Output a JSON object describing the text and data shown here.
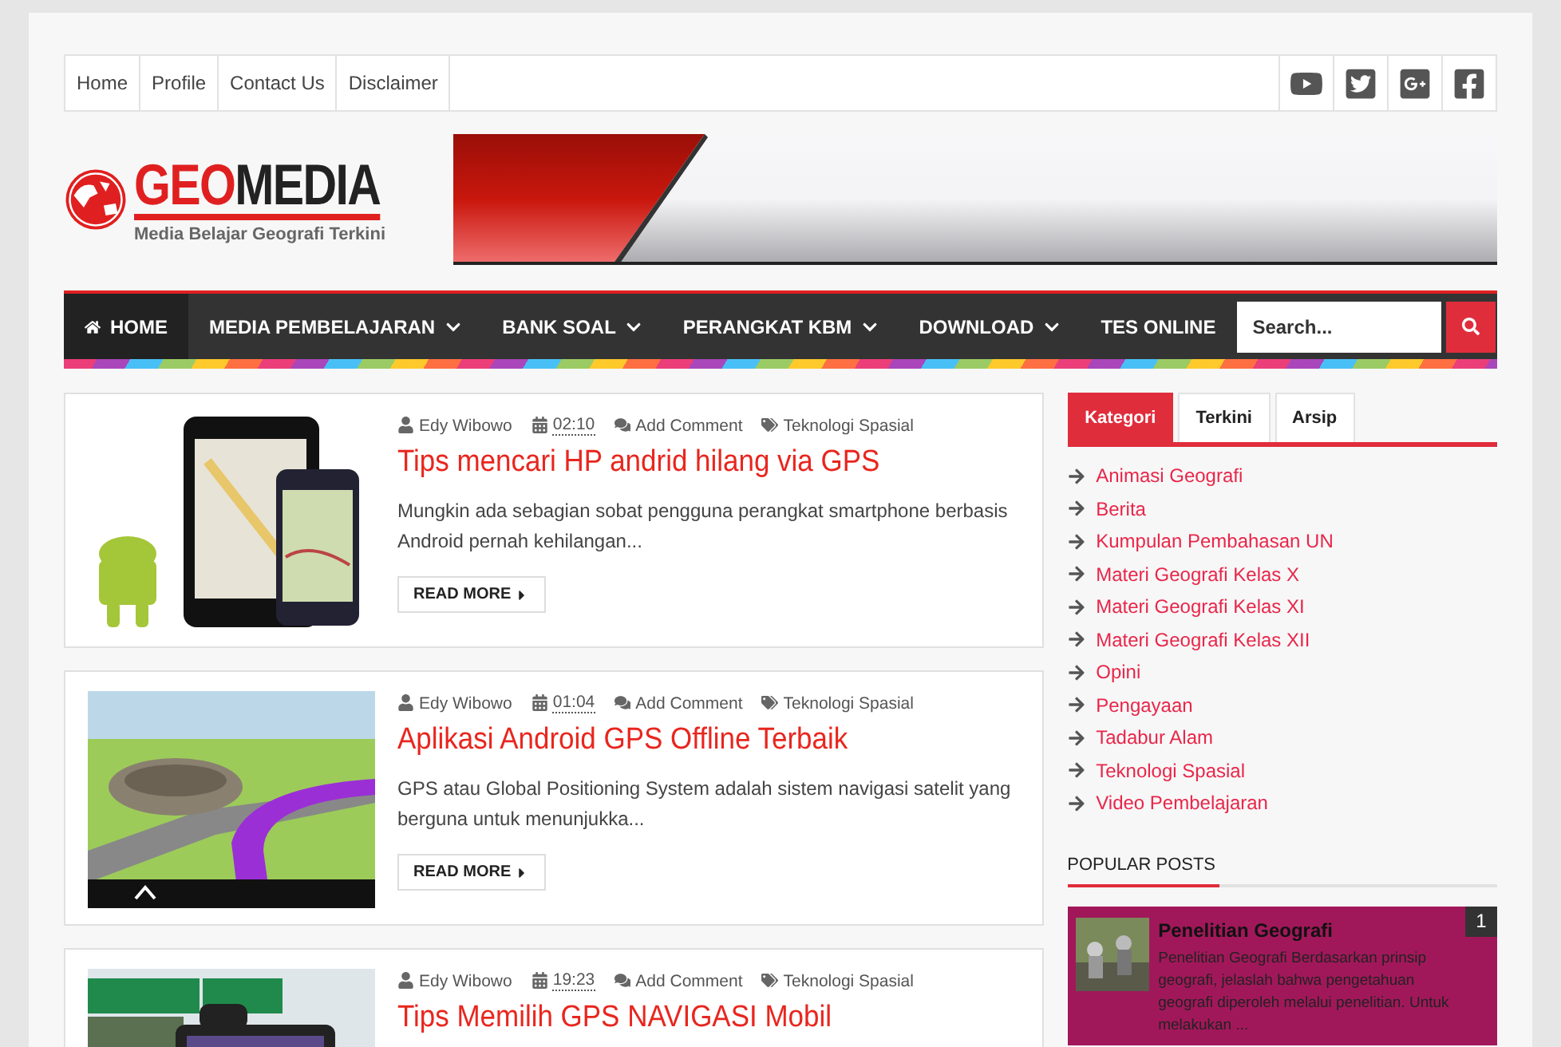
{
  "top_menu": [
    {
      "label": "Home"
    },
    {
      "label": "Profile"
    },
    {
      "label": "Contact Us"
    },
    {
      "label": "Disclaimer"
    }
  ],
  "social": [
    {
      "kind": "youtube"
    },
    {
      "kind": "twitter"
    },
    {
      "kind": "googleplus"
    },
    {
      "kind": "facebook"
    }
  ],
  "logo": {
    "title_accent": "GEO",
    "title_rest": "MEDIA",
    "tagline": "Media Belajar Geografi Terkini"
  },
  "nav": {
    "items": [
      {
        "label": "HOME",
        "kind": "home",
        "dropdown": false,
        "selected": true
      },
      {
        "label": "MEDIA PEMBELAJARAN",
        "kind": "link",
        "dropdown": true,
        "selected": false
      },
      {
        "label": "BANK SOAL",
        "kind": "link",
        "dropdown": true,
        "selected": false
      },
      {
        "label": "PERANGKAT KBM",
        "kind": "link",
        "dropdown": true,
        "selected": false
      },
      {
        "label": "DOWNLOAD",
        "kind": "link",
        "dropdown": true,
        "selected": false
      },
      {
        "label": "TES ONLINE",
        "kind": "link",
        "dropdown": false,
        "selected": false
      }
    ],
    "search": {
      "placeholder": "Search..."
    }
  },
  "posts": [
    {
      "author": "Edy Wibowo",
      "time": "02:10",
      "comments": "Add Comment",
      "category": "Teknologi Spasial",
      "title": "Tips mencari HP andrid hilang via GPS",
      "excerpt": "Mungkin ada sebagian sobat pengguna perangkat smartphone berbasis Android pernah kehilangan...",
      "read_more": "READ MORE"
    },
    {
      "author": "Edy Wibowo",
      "time": "01:04",
      "comments": "Add Comment",
      "category": "Teknologi Spasial",
      "title": "Aplikasi Android GPS Offline Terbaik",
      "excerpt": "GPS atau Global Positioning System adalah sistem navigasi satelit yang berguna untuk menunjukka...",
      "read_more": "READ MORE"
    },
    {
      "author": "Edy Wibowo",
      "time": "19:23",
      "comments": "Add Comment",
      "category": "Teknologi Spasial",
      "title": "Tips Memilih GPS NAVIGASI Mobil"
    }
  ],
  "sidebar": {
    "tabs": [
      {
        "label": "Kategori",
        "selected": true
      },
      {
        "label": "Terkini",
        "selected": false
      },
      {
        "label": "Arsip",
        "selected": false
      }
    ],
    "categories": [
      "Animasi Geografi",
      "Berita",
      "Kumpulan Pembahasan UN",
      "Materi Geografi Kelas X",
      "Materi Geografi Kelas XI",
      "Materi Geografi Kelas XII",
      "Opini",
      "Pengayaan",
      "Tadabur Alam",
      "Teknologi Spasial",
      "Video Pembelajaran"
    ],
    "popular_heading": "POPULAR POSTS",
    "popular_posts": [
      {
        "rank": "1",
        "title": "Penelitian Geografi",
        "excerpt": " Penelitian Geografi Berdasarkan prinsip geografi, jelaslah bahwa pengetahuan geografi diperoleh melalui penelitian. Untuk melakukan ..."
      }
    ]
  }
}
